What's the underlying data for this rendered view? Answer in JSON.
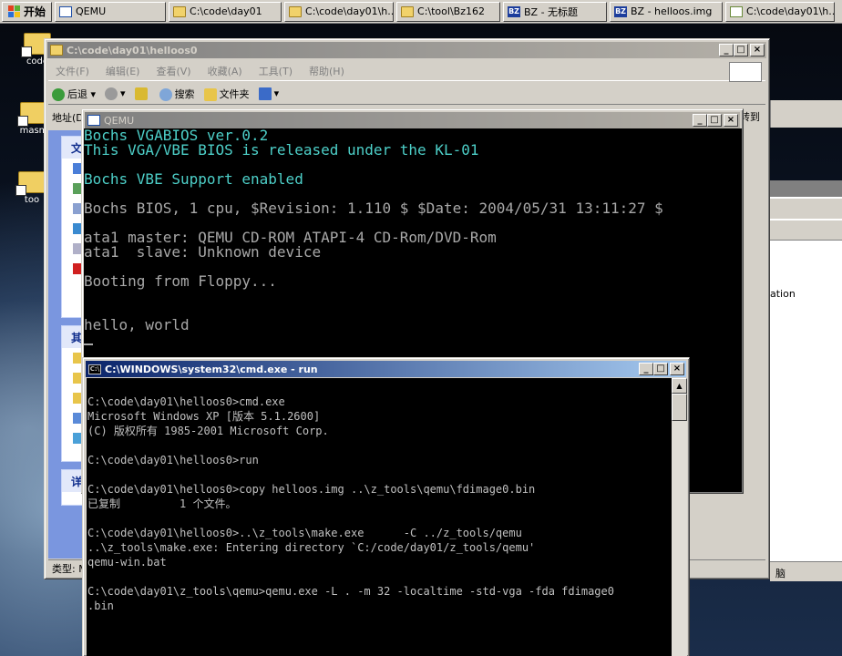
{
  "taskbar": {
    "start_label": "开始",
    "buttons": [
      {
        "label": "QEMU",
        "icon": "qemu-window-icon"
      },
      {
        "label": "C:\\code\\day01",
        "icon": "folder-icon"
      },
      {
        "label": "C:\\code\\day01\\h...",
        "icon": "folder-icon"
      },
      {
        "label": "C:\\tool\\Bz162",
        "icon": "folder-icon"
      },
      {
        "label": "BZ - 无标题",
        "icon": "bz-icon"
      },
      {
        "label": "BZ - helloos.img",
        "icon": "bz-icon"
      },
      {
        "label": "C:\\code\\day01\\h...",
        "icon": "notepad-icon"
      }
    ]
  },
  "desktop_icons": [
    {
      "label": "code"
    },
    {
      "label": "masm"
    },
    {
      "label": "too"
    }
  ],
  "explorer": {
    "title": "C:\\code\\day01\\helloos0",
    "menu": [
      "文件(F)",
      "编辑(E)",
      "查看(V)",
      "收藏(A)",
      "工具(T)",
      "帮助(H)"
    ],
    "toolbar": {
      "back": "后退",
      "search": "搜索",
      "folders": "文件夹"
    },
    "address_label": "地址(D",
    "address_go": "转到",
    "panels": [
      {
        "head": "文"
      },
      {
        "head": "其"
      },
      {
        "head": "详"
      }
    ],
    "status": "类型: M"
  },
  "bg_window": {
    "label": "ation",
    "status": "脑"
  },
  "qemu": {
    "title": "QEMU",
    "lines": [
      {
        "text": "Bochs VGABIOS ver.0.2",
        "color": "cyan"
      },
      {
        "text": "This VGA/VBE BIOS is released under the KL-01",
        "color": "cyan"
      },
      {
        "text": "",
        "color": "grey"
      },
      {
        "text": "Bochs VBE Support enabled",
        "color": "cyan"
      },
      {
        "text": "",
        "color": "grey"
      },
      {
        "text": "Bochs BIOS, 1 cpu, $Revision: 1.110 $ $Date: 2004/05/31 13:11:27 $",
        "color": "grey"
      },
      {
        "text": "",
        "color": "grey"
      },
      {
        "text": "ata1 master: QEMU CD-ROM ATAPI-4 CD-Rom/DVD-Rom",
        "color": "grey"
      },
      {
        "text": "ata1  slave: Unknown device",
        "color": "grey"
      },
      {
        "text": "",
        "color": "grey"
      },
      {
        "text": "Booting from Floppy...",
        "color": "grey"
      },
      {
        "text": "",
        "color": "grey"
      },
      {
        "text": "",
        "color": "grey"
      },
      {
        "text": "hello, world",
        "color": "grey"
      }
    ]
  },
  "cmd": {
    "title": "C:\\WINDOWS\\system32\\cmd.exe - run",
    "lines": [
      "",
      "C:\\code\\day01\\helloos0>cmd.exe",
      "Microsoft Windows XP [版本 5.1.2600]",
      "(C) 版权所有 1985-2001 Microsoft Corp.",
      "",
      "C:\\code\\day01\\helloos0>run",
      "",
      "C:\\code\\day01\\helloos0>copy helloos.img ..\\z_tools\\qemu\\fdimage0.bin",
      "已复制         1 个文件。",
      "",
      "C:\\code\\day01\\helloos0>..\\z_tools\\make.exe      -C ../z_tools/qemu",
      "..\\z_tools\\make.exe: Entering directory `C:/code/day01/z_tools/qemu'",
      "qemu-win.bat",
      "",
      "C:\\code\\day01\\z_tools\\qemu>qemu.exe -L . -m 32 -localtime -std-vga -fda fdimage0",
      ".bin"
    ]
  },
  "colors": {
    "title_active": "#0a246a",
    "title_inactive": "#808080",
    "qemu_cyan": "#4dcfc8",
    "console_grey": "#c0c0c0"
  }
}
